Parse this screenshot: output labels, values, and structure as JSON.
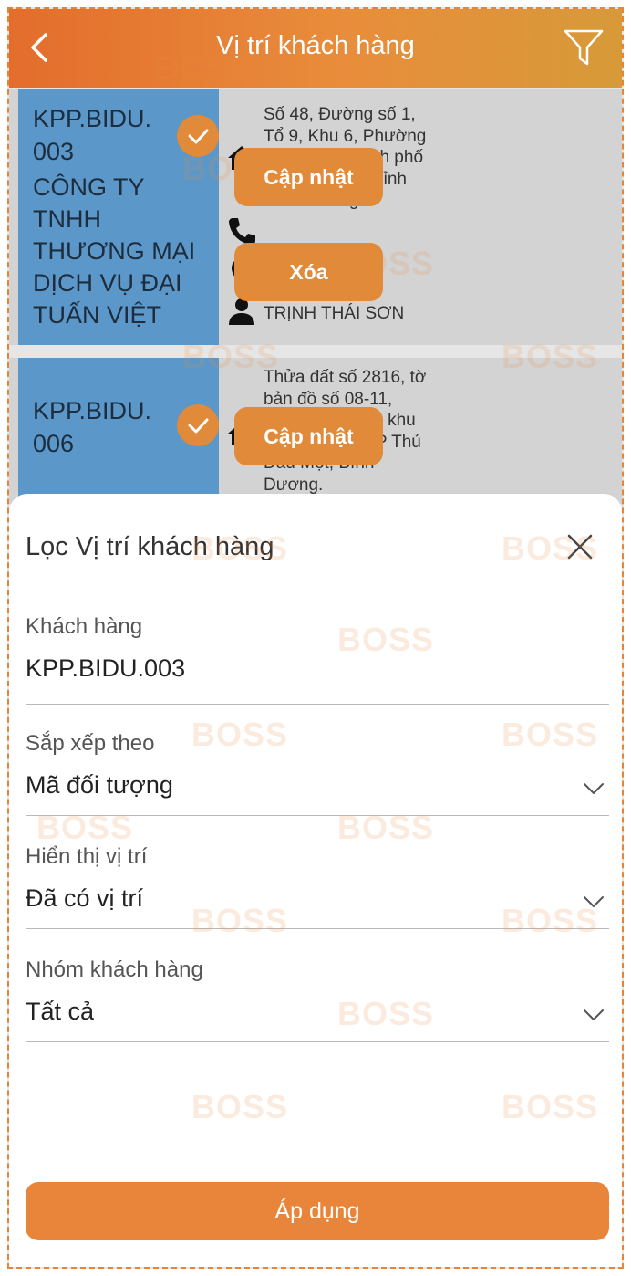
{
  "header": {
    "title": "Vị trí khách hàng",
    "back_icon": "chevron-left-icon",
    "filter_icon": "funnel-icon"
  },
  "cards": [
    {
      "code_line1": "KPP.BIDU.",
      "code_line2": "003",
      "name_lines": [
        "CÔNG TY",
        "TNHH",
        "THƯƠNG MẠI",
        "DỊCH VỤ ĐẠI",
        "TUẤN VIỆT"
      ],
      "address_lines": [
        "Số 48, Đường số 1,",
        "Tổ 9, Khu 6, Phường",
        "Phú Hòa, Thành phố",
        "Thủ Dầu Một, Tỉnh",
        "Bình Dương"
      ],
      "location_status": "Đã có vị trí",
      "contact": "TRỊNH THÁI SƠN",
      "update_label": "Cập nhật",
      "delete_label": "Xóa"
    },
    {
      "code_line1": "KPP.BIDU.",
      "code_line2": "006",
      "address_lines": [
        "Thửa đất số 2816, tờ",
        "bản đồ số 08-11,",
        "đường ĐX 013, khu",
        "6, P.Phú Mỹ, TP Thủ",
        "Dầu Một, Bình",
        "Dương."
      ],
      "update_label": "Cập nhật"
    }
  ],
  "filter_sheet": {
    "title": "Lọc Vị trí khách hàng",
    "fields": [
      {
        "label": "Khách hàng",
        "value": "KPP.BIDU.003"
      },
      {
        "label": "Sắp xếp theo",
        "value": "Mã đối tượng"
      },
      {
        "label": "Hiển thị vị trí",
        "value": "Đã có vị trí"
      },
      {
        "label": "Nhóm khách hàng",
        "value": "Tất cả"
      }
    ],
    "apply_label": "Áp dụng"
  },
  "watermark": {
    "text": "BOSS"
  },
  "colors": {
    "accent": "#e8853a",
    "card_blue": "#5b97c9",
    "card_gray": "#d3d3d3"
  }
}
